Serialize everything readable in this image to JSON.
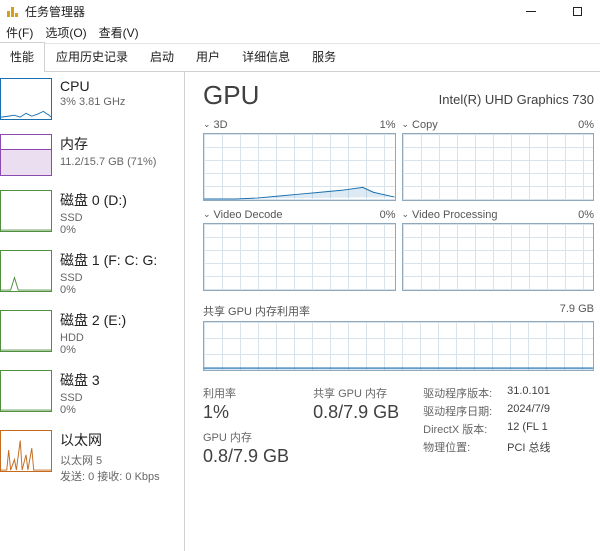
{
  "window": {
    "title": "任务管理器"
  },
  "menu": {
    "file": "件(F)",
    "options": "选项(O)",
    "view": "查看(V)"
  },
  "tabs": {
    "items": [
      "性能",
      "应用历史记录",
      "启动",
      "用户",
      "详细信息",
      "服务"
    ],
    "active_index": 0
  },
  "sidebar": {
    "items": [
      {
        "title": "CPU",
        "line2": "3%  3.81 GHz",
        "kind": "cpu"
      },
      {
        "title": "内存",
        "line2": "11.2/15.7 GB (71%)",
        "kind": "mem"
      },
      {
        "title": "磁盘 0 (D:)",
        "line2": "SSD",
        "line3": "0%",
        "kind": "disk"
      },
      {
        "title": "磁盘 1 (F: C: G:",
        "line2": "SSD",
        "line3": "0%",
        "kind": "disk"
      },
      {
        "title": "磁盘 2 (E:)",
        "line2": "HDD",
        "line3": "0%",
        "kind": "disk"
      },
      {
        "title": "磁盘 3",
        "line2": "SSD",
        "line3": "0%",
        "kind": "disk"
      },
      {
        "title": "以太网",
        "line2": "以太网 5",
        "line3": "发送: 0 接收: 0 Kbps",
        "kind": "net"
      }
    ]
  },
  "gpu": {
    "heading": "GPU",
    "model": "Intel(R) UHD Graphics 730",
    "panels": [
      {
        "name": "3D",
        "pct": "1%"
      },
      {
        "name": "Copy",
        "pct": "0%"
      },
      {
        "name": "Video Decode",
        "pct": "0%"
      },
      {
        "name": "Video Processing",
        "pct": "0%"
      }
    ],
    "shared": {
      "label": "共享 GPU 内存利用率",
      "max": "7.9 GB"
    },
    "stats": {
      "util_label": "利用率",
      "util_value": "1%",
      "shared_label": "共享 GPU 内存",
      "shared_value": "0.8/7.9 GB",
      "gpumem_label": "GPU 内存",
      "gpumem_value": "0.8/7.9 GB"
    },
    "info": {
      "driver_version_label": "驱动程序版本:",
      "driver_version": "31.0.101",
      "driver_date_label": "驱动程序日期:",
      "driver_date": "2024/7/9",
      "directx_label": "DirectX 版本:",
      "directx": "12 (FL 1",
      "location_label": "物理位置:",
      "location": "PCI 总线"
    }
  },
  "chart_data": [
    {
      "type": "line",
      "name": "3D",
      "y_percent": [
        0,
        0,
        0,
        0,
        0,
        1,
        1,
        2,
        3,
        5,
        6,
        4,
        3,
        2,
        3,
        5,
        8,
        6,
        3,
        1
      ],
      "ylim": [
        0,
        100
      ]
    },
    {
      "type": "line",
      "name": "Copy",
      "y_percent": [
        0,
        0,
        0,
        0,
        0,
        0,
        0,
        0,
        0,
        0,
        0,
        0,
        0,
        0,
        0,
        0,
        0,
        0,
        0,
        0
      ],
      "ylim": [
        0,
        100
      ]
    },
    {
      "type": "line",
      "name": "Video Decode",
      "y_percent": [
        0,
        0,
        0,
        0,
        0,
        0,
        0,
        0,
        0,
        0,
        0,
        0,
        0,
        0,
        0,
        0,
        0,
        0,
        0,
        0
      ],
      "ylim": [
        0,
        100
      ]
    },
    {
      "type": "line",
      "name": "Video Processing",
      "y_percent": [
        0,
        0,
        0,
        0,
        0,
        0,
        0,
        0,
        0,
        0,
        0,
        0,
        0,
        0,
        0,
        0,
        0,
        0,
        0,
        0
      ],
      "ylim": [
        0,
        100
      ]
    },
    {
      "type": "line",
      "name": "Shared GPU Memory",
      "y_gb": [
        0.8,
        0.8,
        0.8,
        0.8,
        0.8,
        0.8,
        0.8,
        0.8,
        0.8,
        0.8,
        0.8,
        0.8,
        0.8,
        0.8,
        0.8,
        0.8,
        0.8,
        0.8,
        0.8,
        0.8
      ],
      "ylim": [
        0,
        7.9
      ]
    }
  ]
}
